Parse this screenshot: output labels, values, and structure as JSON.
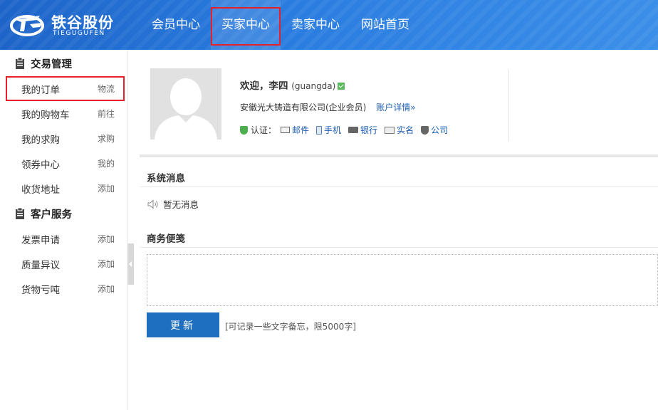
{
  "header": {
    "logo_cn": "铁谷股份",
    "logo_en": "TIEGUGUFEN",
    "nav": [
      {
        "label": "会员中心"
      },
      {
        "label": "买家中心"
      },
      {
        "label": "卖家中心"
      },
      {
        "label": "网站首页"
      }
    ],
    "active_nav": "买家中心"
  },
  "sidebar": {
    "sections": [
      {
        "title": "交易管理",
        "items": [
          {
            "label": "我的订单",
            "right": "物流"
          },
          {
            "label": "我的购物车",
            "right": "前往"
          },
          {
            "label": "我的求购",
            "right": "求购"
          },
          {
            "label": "领券中心",
            "right": "我的"
          },
          {
            "label": "收货地址",
            "right": "添加"
          }
        ]
      },
      {
        "title": "客户服务",
        "items": [
          {
            "label": "发票申请",
            "right": "添加"
          },
          {
            "label": "质量异议",
            "right": "添加"
          },
          {
            "label": "货物亏吨",
            "right": "添加"
          }
        ]
      }
    ],
    "selected_item": "我的订单"
  },
  "profile": {
    "welcome": "欢迎，李四",
    "username": "(guangda)",
    "company": "安徽光大铸造有限公司(企业会员)",
    "account_link": "账户详情»",
    "auth_label": "认证：",
    "auth_items": [
      "邮件",
      "手机",
      "银行",
      "实名",
      "公司"
    ]
  },
  "messages": {
    "title": "系统消息",
    "empty": "暂无消息"
  },
  "memo": {
    "title": "商务便笺",
    "value": "",
    "button": "更新",
    "hint": "[可记录一些文字备忘，限5000字]"
  },
  "colors": {
    "header": "#2a7de0",
    "highlight": "#e8202a",
    "button": "#1e6fc0",
    "link": "#1e5fb4"
  }
}
